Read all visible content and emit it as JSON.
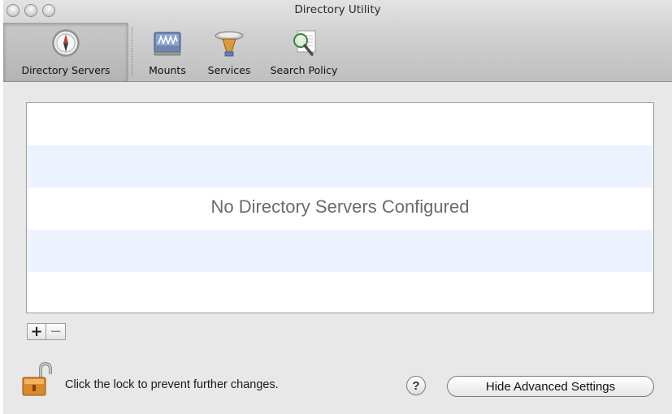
{
  "window": {
    "title": "Directory Utility"
  },
  "toolbar": {
    "items": [
      {
        "label": "Directory Servers",
        "icon": "compass-icon",
        "selected": true
      },
      {
        "label": "Mounts",
        "icon": "mounts-icon",
        "selected": false
      },
      {
        "label": "Services",
        "icon": "services-icon",
        "selected": false
      },
      {
        "label": "Search Policy",
        "icon": "search-policy-icon",
        "selected": false
      }
    ]
  },
  "list": {
    "empty_message": "No Directory Servers Configured",
    "stripe_color": "#edf3fe"
  },
  "controls": {
    "add_label": "+",
    "remove_label": "−"
  },
  "footer": {
    "lock_text": "Click the lock to prevent further changes.",
    "help_label": "?",
    "hide_advanced_label": "Hide Advanced Settings"
  }
}
